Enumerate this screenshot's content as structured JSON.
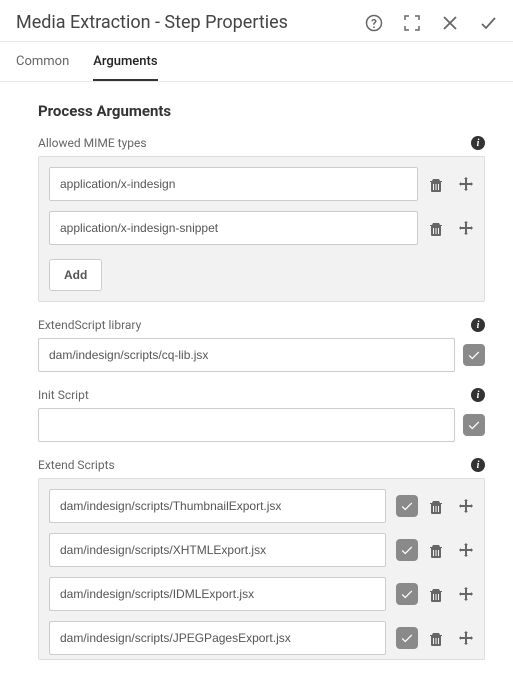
{
  "header": {
    "title": "Media Extraction - Step Properties"
  },
  "tabs": {
    "common": "Common",
    "arguments": "Arguments"
  },
  "section": {
    "title": "Process Arguments"
  },
  "allowed_mime": {
    "label": "Allowed MIME types",
    "items": [
      "application/x-indesign",
      "application/x-indesign-snippet"
    ],
    "add_label": "Add"
  },
  "extendscript_library": {
    "label": "ExtendScript library",
    "value": "dam/indesign/scripts/cq-lib.jsx"
  },
  "init_script": {
    "label": "Init Script",
    "value": ""
  },
  "extend_scripts": {
    "label": "Extend Scripts",
    "items": [
      "dam/indesign/scripts/ThumbnailExport.jsx",
      "dam/indesign/scripts/XHTMLExport.jsx",
      "dam/indesign/scripts/IDMLExport.jsx",
      "dam/indesign/scripts/JPEGPagesExport.jsx"
    ]
  }
}
